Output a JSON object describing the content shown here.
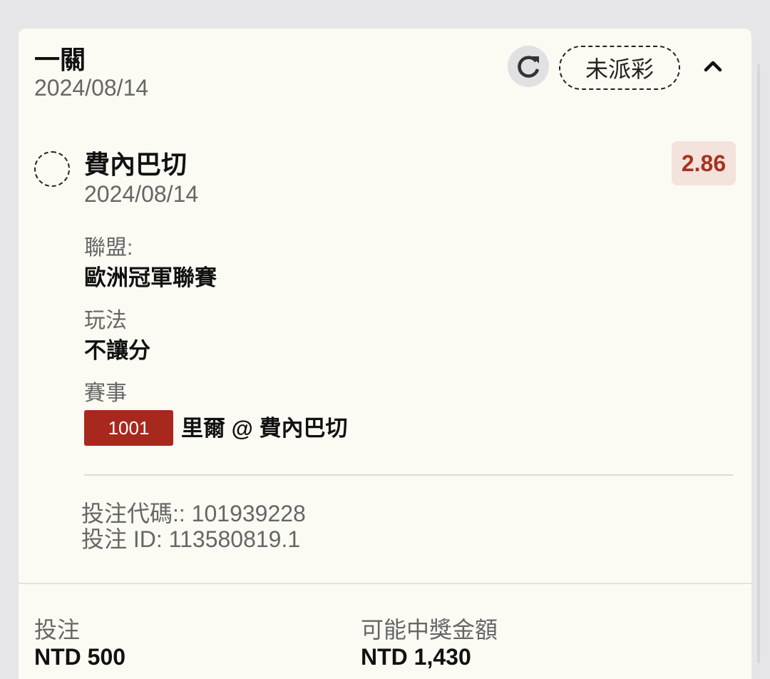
{
  "bet": {
    "type": "一關",
    "date": "2024/08/14",
    "status": "未派彩"
  },
  "icons": {
    "refresh": "refresh-icon",
    "collapse": "chevron-up-icon",
    "selection": "dashed-circle-icon"
  },
  "selection": {
    "team": "費內巴切",
    "date": "2024/08/14",
    "odds": "2.86",
    "league_label": "聯盟:",
    "league_value": "歐洲冠軍聯賽",
    "market_label": "玩法",
    "market_value": "不讓分",
    "event_label": "賽事",
    "event_code": "1001",
    "event_name": "里爾 @ 費內巴切"
  },
  "ticket": {
    "code": "投注代碼:: 101939228",
    "id": "投注 ID: 113580819.1"
  },
  "summary": {
    "stake_label": "投注",
    "stake_value": "NTD 500",
    "payout_label": "可能中獎金額",
    "payout_value": "NTD 1,430"
  },
  "colors": {
    "card_bg": "#fbfbf4",
    "page_bg": "#e6e6e8",
    "odds_text": "#a63420",
    "odds_bg": "#f4e2dc",
    "event_code_bg": "#a8281e"
  }
}
